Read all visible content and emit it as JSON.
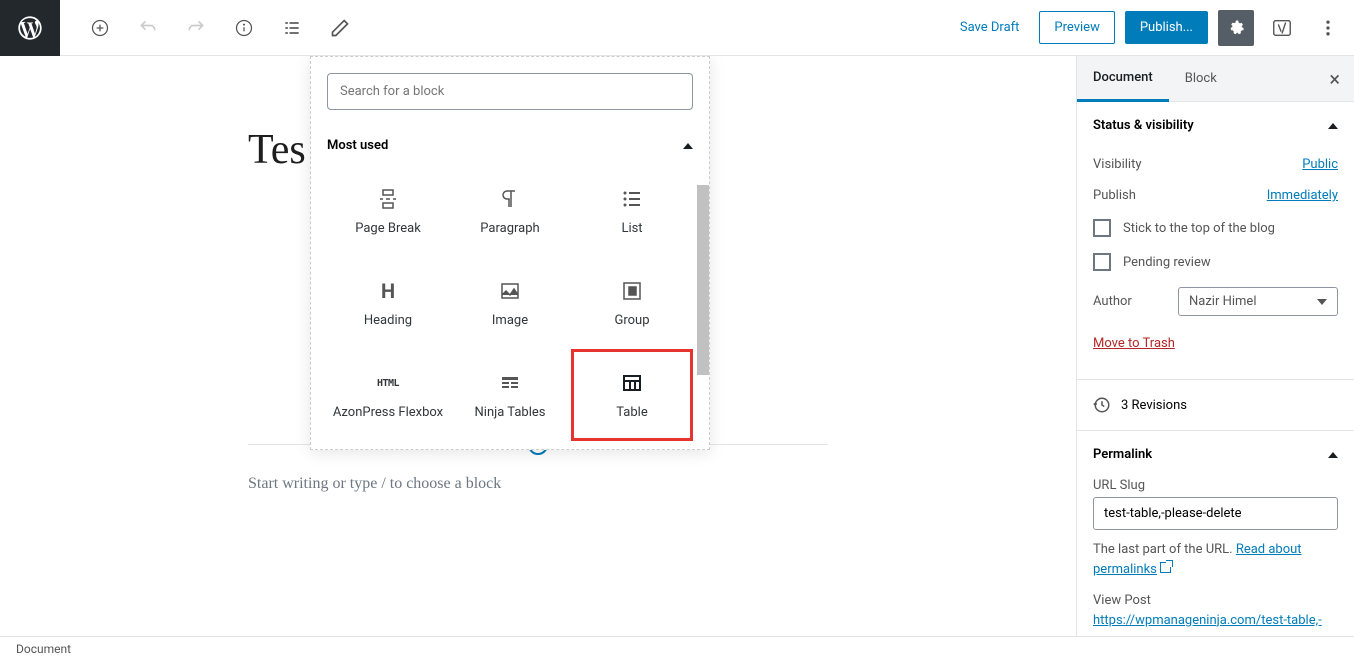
{
  "topbar": {
    "save_draft": "Save Draft",
    "preview": "Preview",
    "publish": "Publish..."
  },
  "inserter": {
    "search_placeholder": "Search for a block",
    "section_title": "Most used",
    "blocks": [
      {
        "label": "Page Break"
      },
      {
        "label": "Paragraph"
      },
      {
        "label": "List"
      },
      {
        "label": "Heading"
      },
      {
        "label": "Image"
      },
      {
        "label": "Group"
      },
      {
        "label": "AzonPress Flexbox"
      },
      {
        "label": "Ninja Tables"
      },
      {
        "label": "Table"
      }
    ]
  },
  "editor": {
    "title": "Tes",
    "prompt": "Start writing or type / to choose a block"
  },
  "sidebar": {
    "tabs": {
      "document": "Document",
      "block": "Block"
    },
    "status": {
      "title": "Status & visibility",
      "visibility_label": "Visibility",
      "visibility_value": "Public",
      "publish_label": "Publish",
      "publish_value": "Immediately",
      "stick": "Stick to the top of the blog",
      "pending": "Pending review",
      "author_label": "Author",
      "author_value": "Nazir Himel",
      "trash": "Move to Trash"
    },
    "revisions": "3 Revisions",
    "permalink": {
      "title": "Permalink",
      "slug_label": "URL Slug",
      "slug_value": "test-table,-please-delete",
      "help1": "The last part of the URL. ",
      "help_link": "Read about permalinks",
      "view_post": "View Post",
      "url": "https://wpmanageninja.com/test-table,-"
    }
  },
  "footer": {
    "breadcrumb": "Document"
  }
}
